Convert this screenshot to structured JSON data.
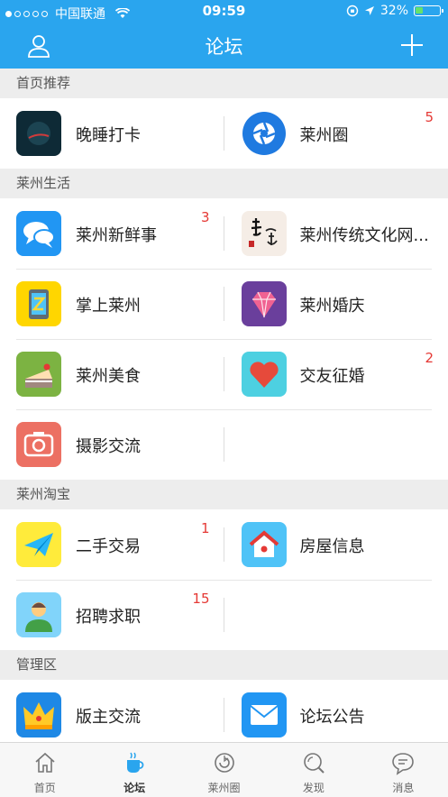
{
  "status_bar": {
    "carrier": "中国联通",
    "time": "09:59",
    "battery": "32%",
    "battery_level": 0.32
  },
  "nav": {
    "title": "论坛"
  },
  "sections": [
    {
      "title": "首页推荐",
      "items": [
        {
          "label": "晚睡打卡",
          "badge": "",
          "icon": "moon-photo-icon"
        },
        {
          "label": "莱州圈",
          "badge": "5",
          "icon": "camera-shutter-icon"
        }
      ]
    },
    {
      "title": "莱州生活",
      "items": [
        {
          "label": "莱州新鲜事",
          "badge": "3",
          "icon": "chat-bubbles-icon"
        },
        {
          "label": "莱州传统文化网...",
          "badge": "",
          "icon": "calligraphy-icon"
        },
        {
          "label": "掌上莱州",
          "badge": "",
          "icon": "phone-icon"
        },
        {
          "label": "莱州婚庆",
          "badge": "",
          "icon": "diamond-icon"
        },
        {
          "label": "莱州美食",
          "badge": "",
          "icon": "cake-icon"
        },
        {
          "label": "交友征婚",
          "badge": "2",
          "icon": "heart-icon"
        },
        {
          "label": "摄影交流",
          "badge": "",
          "icon": "camera-icon"
        }
      ]
    },
    {
      "title": "莱州淘宝",
      "items": [
        {
          "label": "二手交易",
          "badge": "1",
          "icon": "paper-plane-icon"
        },
        {
          "label": "房屋信息",
          "badge": "",
          "icon": "house-icon"
        },
        {
          "label": "招聘求职",
          "badge": "15",
          "icon": "person-icon"
        }
      ]
    },
    {
      "title": "管理区",
      "items": [
        {
          "label": "版主交流",
          "badge": "",
          "icon": "crown-icon"
        },
        {
          "label": "论坛公告",
          "badge": "",
          "icon": "envelope-icon"
        }
      ]
    }
  ],
  "tabs": [
    {
      "label": "首页",
      "icon": "home-icon",
      "active": false
    },
    {
      "label": "论坛",
      "icon": "cup-icon",
      "active": true
    },
    {
      "label": "莱州圈",
      "icon": "circle-icon",
      "active": false
    },
    {
      "label": "发现",
      "icon": "discover-icon",
      "active": false
    },
    {
      "label": "消息",
      "icon": "message-icon",
      "active": false
    }
  ],
  "colors": {
    "header": "#2aa5ee",
    "badge": "#e53935"
  }
}
